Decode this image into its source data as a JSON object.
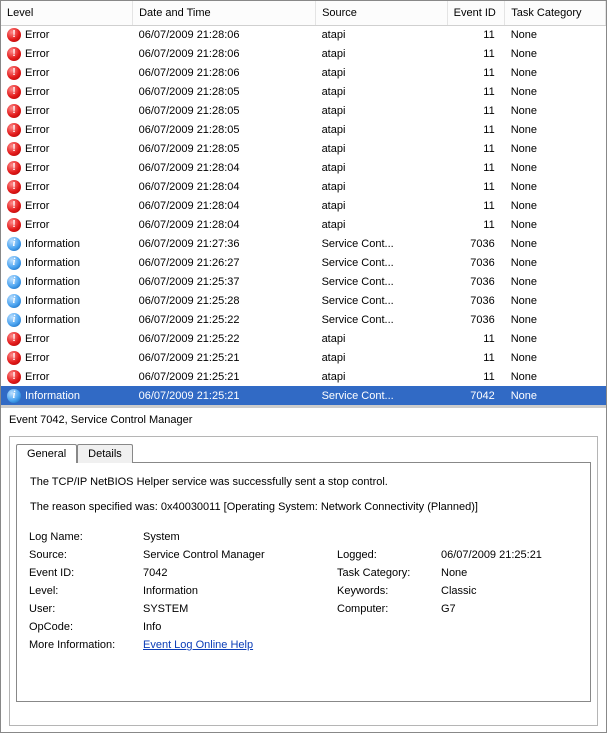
{
  "columns": {
    "level": "Level",
    "datetime": "Date and Time",
    "source": "Source",
    "eventid": "Event ID",
    "task": "Task Category"
  },
  "level_labels": {
    "error": "Error",
    "info": "Information"
  },
  "events": [
    {
      "lvl": "error",
      "dt": "06/07/2009 21:28:06",
      "src": "atapi",
      "id": "11",
      "task": "None",
      "sel": false
    },
    {
      "lvl": "error",
      "dt": "06/07/2009 21:28:06",
      "src": "atapi",
      "id": "11",
      "task": "None",
      "sel": false
    },
    {
      "lvl": "error",
      "dt": "06/07/2009 21:28:06",
      "src": "atapi",
      "id": "11",
      "task": "None",
      "sel": false
    },
    {
      "lvl": "error",
      "dt": "06/07/2009 21:28:05",
      "src": "atapi",
      "id": "11",
      "task": "None",
      "sel": false
    },
    {
      "lvl": "error",
      "dt": "06/07/2009 21:28:05",
      "src": "atapi",
      "id": "11",
      "task": "None",
      "sel": false
    },
    {
      "lvl": "error",
      "dt": "06/07/2009 21:28:05",
      "src": "atapi",
      "id": "11",
      "task": "None",
      "sel": false
    },
    {
      "lvl": "error",
      "dt": "06/07/2009 21:28:05",
      "src": "atapi",
      "id": "11",
      "task": "None",
      "sel": false
    },
    {
      "lvl": "error",
      "dt": "06/07/2009 21:28:04",
      "src": "atapi",
      "id": "11",
      "task": "None",
      "sel": false
    },
    {
      "lvl": "error",
      "dt": "06/07/2009 21:28:04",
      "src": "atapi",
      "id": "11",
      "task": "None",
      "sel": false
    },
    {
      "lvl": "error",
      "dt": "06/07/2009 21:28:04",
      "src": "atapi",
      "id": "11",
      "task": "None",
      "sel": false
    },
    {
      "lvl": "error",
      "dt": "06/07/2009 21:28:04",
      "src": "atapi",
      "id": "11",
      "task": "None",
      "sel": false
    },
    {
      "lvl": "info",
      "dt": "06/07/2009 21:27:36",
      "src": "Service Cont...",
      "id": "7036",
      "task": "None",
      "sel": false
    },
    {
      "lvl": "info",
      "dt": "06/07/2009 21:26:27",
      "src": "Service Cont...",
      "id": "7036",
      "task": "None",
      "sel": false
    },
    {
      "lvl": "info",
      "dt": "06/07/2009 21:25:37",
      "src": "Service Cont...",
      "id": "7036",
      "task": "None",
      "sel": false
    },
    {
      "lvl": "info",
      "dt": "06/07/2009 21:25:28",
      "src": "Service Cont...",
      "id": "7036",
      "task": "None",
      "sel": false
    },
    {
      "lvl": "info",
      "dt": "06/07/2009 21:25:22",
      "src": "Service Cont...",
      "id": "7036",
      "task": "None",
      "sel": false
    },
    {
      "lvl": "error",
      "dt": "06/07/2009 21:25:22",
      "src": "atapi",
      "id": "11",
      "task": "None",
      "sel": false
    },
    {
      "lvl": "error",
      "dt": "06/07/2009 21:25:21",
      "src": "atapi",
      "id": "11",
      "task": "None",
      "sel": false
    },
    {
      "lvl": "error",
      "dt": "06/07/2009 21:25:21",
      "src": "atapi",
      "id": "11",
      "task": "None",
      "sel": false
    },
    {
      "lvl": "info",
      "dt": "06/07/2009 21:25:21",
      "src": "Service Cont...",
      "id": "7042",
      "task": "None",
      "sel": true
    }
  ],
  "details": {
    "header": "Event 7042, Service Control Manager",
    "tabs": {
      "general": "General",
      "details": "Details"
    },
    "description_line1": "The TCP/IP NetBIOS Helper service was successfully sent a stop control.",
    "description_line2": "The reason specified was: 0x40030011 [Operating System: Network Connectivity (Planned)]",
    "props": {
      "log_name_lbl": "Log Name:",
      "log_name_val": "System",
      "source_lbl": "Source:",
      "source_val": "Service Control Manager",
      "logged_lbl": "Logged:",
      "logged_val": "06/07/2009 21:25:21",
      "eventid_lbl": "Event ID:",
      "eventid_val": "7042",
      "taskcat_lbl": "Task Category:",
      "taskcat_val": "None",
      "level_lbl": "Level:",
      "level_val": "Information",
      "keywords_lbl": "Keywords:",
      "keywords_val": "Classic",
      "user_lbl": "User:",
      "user_val": "SYSTEM",
      "computer_lbl": "Computer:",
      "computer_val": "G7",
      "opcode_lbl": "OpCode:",
      "opcode_val": "Info",
      "moreinfo_lbl": "More Information:",
      "moreinfo_link": "Event Log Online Help"
    }
  }
}
